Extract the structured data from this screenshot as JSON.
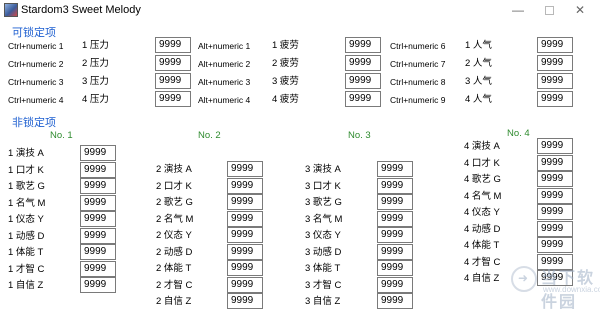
{
  "window": {
    "title": "Stardom3 Sweet Melody"
  },
  "locked_section": {
    "title": "可锁定项",
    "columns": [
      {
        "rows": [
          {
            "hotkey": "Ctrl+numeric 1",
            "label": "1 压力",
            "value": "9999"
          },
          {
            "hotkey": "Ctrl+numeric 2",
            "label": "2 压力",
            "value": "9999"
          },
          {
            "hotkey": "Ctrl+numeric 3",
            "label": "3 压力",
            "value": "9999"
          },
          {
            "hotkey": "Ctrl+numeric 4",
            "label": "4 压力",
            "value": "9999"
          }
        ]
      },
      {
        "rows": [
          {
            "hotkey": "Alt+numeric 1",
            "label": "1 疲劳",
            "value": "9999"
          },
          {
            "hotkey": "Alt+numeric 2",
            "label": "2 疲劳",
            "value": "9999"
          },
          {
            "hotkey": "Alt+numeric 3",
            "label": "3 疲劳",
            "value": "9999"
          },
          {
            "hotkey": "Alt+numeric 4",
            "label": "4 疲劳",
            "value": "9999"
          }
        ]
      },
      {
        "rows": [
          {
            "hotkey": "Ctrl+numeric 6",
            "label": "1 人气",
            "value": "9999"
          },
          {
            "hotkey": "Ctrl+numeric 7",
            "label": "2 人气",
            "value": "9999"
          },
          {
            "hotkey": "Ctrl+numeric 8",
            "label": "3 人气",
            "value": "9999"
          },
          {
            "hotkey": "Ctrl+numeric 9",
            "label": "4 人气",
            "value": "9999"
          }
        ]
      }
    ]
  },
  "unlocked_section": {
    "title": "非锁定项",
    "columns": [
      {
        "header": "No. 1",
        "rows": [
          {
            "label": "1 演技 A",
            "value": "9999"
          },
          {
            "label": "1 口才 K",
            "value": "9999"
          },
          {
            "label": "1 歌艺 G",
            "value": "9999"
          },
          {
            "label": "1 名气 M",
            "value": "9999"
          },
          {
            "label": "1 仪态 Y",
            "value": "9999"
          },
          {
            "label": "1 动感 D",
            "value": "9999"
          },
          {
            "label": "1 体能 T",
            "value": "9999"
          },
          {
            "label": "1 才智 C",
            "value": "9999"
          },
          {
            "label": "1 自信 Z",
            "value": "9999"
          }
        ]
      },
      {
        "header": "No. 2",
        "rows": [
          {
            "label": "2 演技 A",
            "value": "9999"
          },
          {
            "label": "2 口才 K",
            "value": "9999"
          },
          {
            "label": "2 歌艺 G",
            "value": "9999"
          },
          {
            "label": "2 名气 M",
            "value": "9999"
          },
          {
            "label": "2 仪态 Y",
            "value": "9999"
          },
          {
            "label": "2 动感 D",
            "value": "9999"
          },
          {
            "label": "2 体能 T",
            "value": "9999"
          },
          {
            "label": "2 才智 C",
            "value": "9999"
          },
          {
            "label": "2 自信 Z",
            "value": "9999"
          }
        ]
      },
      {
        "header": "No. 3",
        "rows": [
          {
            "label": "3 演技 A",
            "value": "9999"
          },
          {
            "label": "3 口才 K",
            "value": "9999"
          },
          {
            "label": "3 歌艺 G",
            "value": "9999"
          },
          {
            "label": "3 名气 M",
            "value": "9999"
          },
          {
            "label": "3 仪态 Y",
            "value": "9999"
          },
          {
            "label": "3 动感 D",
            "value": "9999"
          },
          {
            "label": "3 体能 T",
            "value": "9999"
          },
          {
            "label": "3 才智 C",
            "value": "9999"
          },
          {
            "label": "3 自信 Z",
            "value": "9999"
          }
        ]
      },
      {
        "header": "No. 4",
        "rows": [
          {
            "label": "4 演技 A",
            "value": "9999"
          },
          {
            "label": "4 口才 K",
            "value": "9999"
          },
          {
            "label": "4 歌艺 G",
            "value": "9999"
          },
          {
            "label": "4 名气 M",
            "value": "9999"
          },
          {
            "label": "4 仪态 Y",
            "value": "9999"
          },
          {
            "label": "4 动感 D",
            "value": "9999"
          },
          {
            "label": "4 体能 T",
            "value": "9999"
          },
          {
            "label": "4 才智 C",
            "value": "9999"
          },
          {
            "label": "4 自信 Z",
            "value": "9999"
          }
        ]
      }
    ]
  },
  "watermark": {
    "text": "当下软件园",
    "url": "www.downxia.com"
  },
  "colors": {
    "section_title": "#1e5fd0",
    "column_header": "#2e8b2e"
  }
}
